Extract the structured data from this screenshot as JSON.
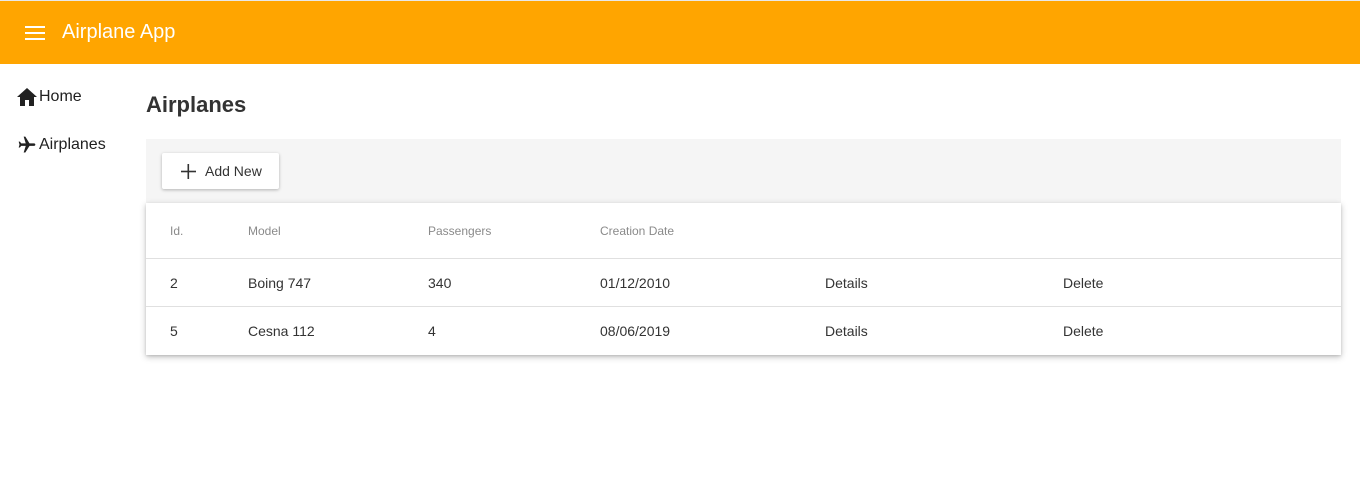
{
  "header": {
    "app_title": "Airplane App",
    "background_color": "#ffa500",
    "menu_icon": "menu-icon"
  },
  "sidebar": {
    "items": [
      {
        "label": "Home",
        "icon": "home-icon"
      },
      {
        "label": "Airplanes",
        "icon": "airplane-icon"
      }
    ]
  },
  "main": {
    "title": "Airplanes",
    "add_button_label": "Add New",
    "add_button_icon": "plus-icon",
    "table": {
      "columns": [
        "Id.",
        "Model",
        "Passengers",
        "Creation Date"
      ],
      "rows": [
        {
          "id": "2",
          "model": "Boing 747",
          "passengers": "340",
          "creation_date": "01/12/2010",
          "details": "Details",
          "delete": "Delete"
        },
        {
          "id": "5",
          "model": "Cesna 112",
          "passengers": "4",
          "creation_date": "08/06/2019",
          "details": "Details",
          "delete": "Delete"
        }
      ]
    }
  }
}
